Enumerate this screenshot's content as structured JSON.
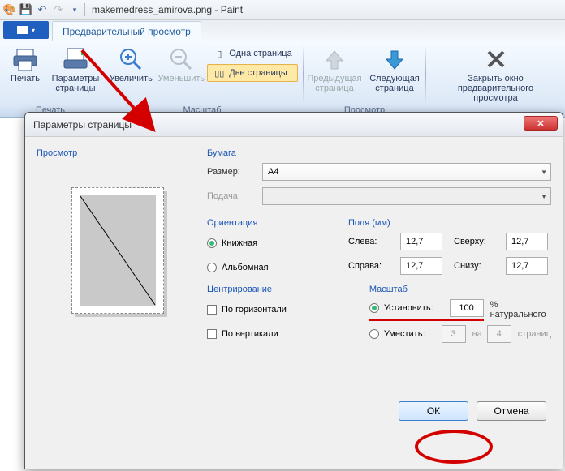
{
  "title": "makemedress_amirova.png - Paint",
  "qat": {
    "save": "save-icon",
    "undo": "undo-icon",
    "redo": "redo-icon"
  },
  "tabs": {
    "preview": "Предварительный просмотр"
  },
  "ribbon": {
    "print_group": "Печать",
    "print": "Печать",
    "page_setup": "Параметры страницы",
    "scale_group": "Масштаб",
    "zoom_in": "Увеличить",
    "zoom_out": "Уменьшить",
    "one_page": "Одна страница",
    "two_pages": "Две страницы",
    "view_group": "Просмотр",
    "prev_page": "Предыдущая страница",
    "next_page": "Следующая страница",
    "close": "Закрыть окно предварительного просмотра"
  },
  "dialog": {
    "title": "Параметры страницы",
    "preview": "Просмотр",
    "paper": "Бумага",
    "size_lbl": "Размер:",
    "size_val": "A4",
    "source_lbl": "Подача:",
    "orientation": "Ориентация",
    "portrait": "Книжная",
    "landscape": "Альбомная",
    "margins": "Поля (мм)",
    "left": "Слева:",
    "right": "Справа:",
    "top": "Сверху:",
    "bottom": "Снизу:",
    "m_left": "12,7",
    "m_right": "12,7",
    "m_top": "12,7",
    "m_bottom": "12,7",
    "centering": "Центрирование",
    "horiz": "По горизонтали",
    "vert": "По вертикали",
    "scale": "Масштаб",
    "adjust": "Установить:",
    "adjust_val": "100",
    "adjust_suffix": "% натурального",
    "fit": "Уместить:",
    "fit_w": "3",
    "fit_mid": "на",
    "fit_h": "4",
    "fit_suffix": "страниц",
    "ok": "ОК",
    "cancel": "Отмена"
  }
}
